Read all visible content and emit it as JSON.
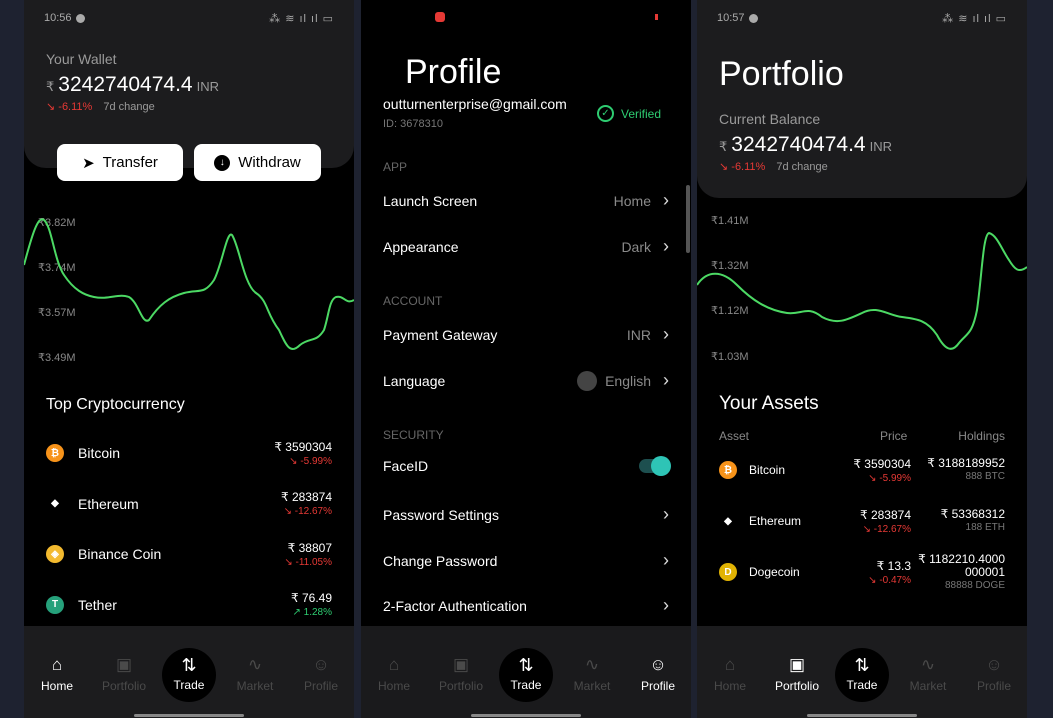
{
  "colors": {
    "accent": "#2ecc71",
    "negative": "#e53935",
    "line": "#4cd964",
    "teal": "#2ec4b6"
  },
  "wallet": {
    "time": "10:56",
    "label": "Your Wallet",
    "currency_symbol": "₹",
    "balance": "3242740474.4",
    "unit": "INR",
    "change": "-6.11%",
    "change_label": "7d change",
    "transfer": "Transfer",
    "withdraw": "Withdraw",
    "axis": [
      "₹3.82M",
      "₹3.74M",
      "₹3.57M",
      "₹3.49M"
    ],
    "top_title": "Top Cryptocurrency",
    "coins": [
      {
        "name": "Bitcoin",
        "price": "₹ 3590304",
        "change": "-5.99%",
        "icon": "bitcoin-icon",
        "color": "#f7931a",
        "glyph": "₿"
      },
      {
        "name": "Ethereum",
        "price": "₹ 283874",
        "change": "-12.67%",
        "icon": "ethereum-icon",
        "color": "#000",
        "glyph": "◆"
      },
      {
        "name": "Binance Coin",
        "price": "₹ 38807",
        "change": "-11.05%",
        "icon": "binance-icon",
        "color": "#f3ba2f",
        "glyph": "◈"
      },
      {
        "name": "Tether",
        "price": "₹ 76.49",
        "change": "1.28%",
        "icon": "tether-icon",
        "color": "#26a17b",
        "glyph": "T"
      }
    ]
  },
  "profile": {
    "title": "Profile",
    "email": "outturnenterprise@gmail.com",
    "id": "ID: 3678310",
    "verified": "Verified",
    "sections": {
      "app": "APP",
      "account": "ACCOUNT",
      "security": "SECURITY"
    },
    "launch_screen": {
      "label": "Launch Screen",
      "value": "Home"
    },
    "appearance": {
      "label": "Appearance",
      "value": "Dark"
    },
    "payment_gateway": {
      "label": "Payment Gateway",
      "value": "INR"
    },
    "language": {
      "label": "Language",
      "value": "English"
    },
    "faceid": {
      "label": "FaceID",
      "enabled": true
    },
    "password_settings": "Password Settings",
    "change_password": "Change Password",
    "two_factor": "2-Factor Authentication"
  },
  "portfolio": {
    "time": "10:57",
    "title": "Portfolio",
    "balance_label": "Current Balance",
    "currency_symbol": "₹",
    "balance": "3242740474.4",
    "unit": "INR",
    "change": "-6.11%",
    "change_label": "7d change",
    "axis": [
      "₹1.41M",
      "₹1.32M",
      "₹1.12M",
      "₹1.03M"
    ],
    "assets_title": "Your Assets",
    "headers": {
      "asset": "Asset",
      "price": "Price",
      "holdings": "Holdings"
    },
    "assets": [
      {
        "name": "Bitcoin",
        "price": "₹ 3590304",
        "change": "-5.99%",
        "holdings": "₹ 3188189952",
        "qty": "888 BTC",
        "icon": "bitcoin-icon",
        "color": "#f7931a",
        "glyph": "₿"
      },
      {
        "name": "Ethereum",
        "price": "₹ 283874",
        "change": "-12.67%",
        "holdings": "₹ 53368312",
        "qty": "188 ETH",
        "icon": "ethereum-icon",
        "color": "#000",
        "glyph": "◆"
      },
      {
        "name": "Dogecoin",
        "price": "₹ 13.3",
        "change": "-0.47%",
        "holdings_line1": "₹ 1182210.4000",
        "holdings_line2": "000001",
        "qty": "88888 DOGE",
        "icon": "dogecoin-icon",
        "color": "#e1b303",
        "glyph": "D"
      }
    ]
  },
  "nav": {
    "home": "Home",
    "portfolio": "Portfolio",
    "trade": "Trade",
    "market": "Market",
    "profile": "Profile"
  }
}
